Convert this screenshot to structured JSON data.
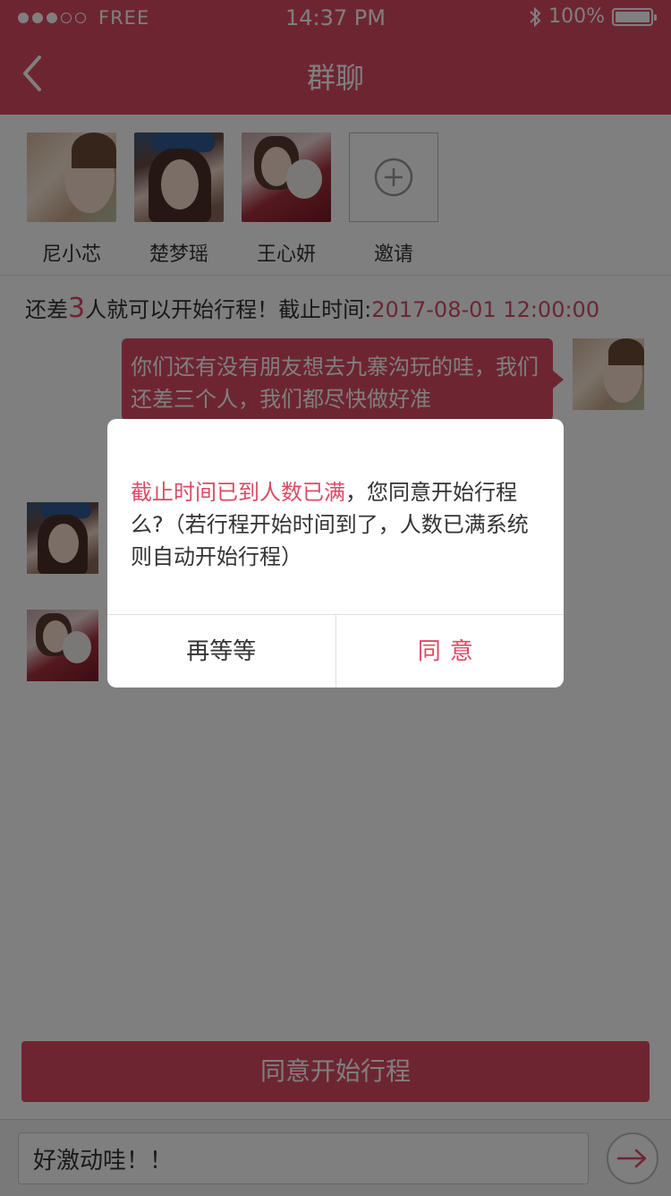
{
  "status_bar": {
    "carrier": "FREE",
    "time": "14:37 PM",
    "battery": "100%"
  },
  "nav": {
    "title": "群聊"
  },
  "members": [
    {
      "name": "尼小芯"
    },
    {
      "name": "楚梦瑶"
    },
    {
      "name": "王心妍"
    },
    {
      "name": "邀请"
    }
  ],
  "notice": {
    "prefix": "还差",
    "count": "3",
    "middle": "人就可以开始行程！截止时间:",
    "deadline": "2017-08-01 12:00:00"
  },
  "chat": {
    "message_text": "你们还有没有朋友想去九寨沟玩的哇，我们还差三个人，我们都尽快做好准"
  },
  "start_button": {
    "label": "同意开始行程"
  },
  "input": {
    "value": "好激动哇！！"
  },
  "dialog": {
    "highlight": "截止时间已到人数已满",
    "message": "，您同意开始行程么?（若行程开始时间到了，人数已满系统则自动开始行程）",
    "wait_label": "再等等",
    "agree_label": "同意"
  },
  "colors": {
    "accent": "#dd4a64"
  }
}
